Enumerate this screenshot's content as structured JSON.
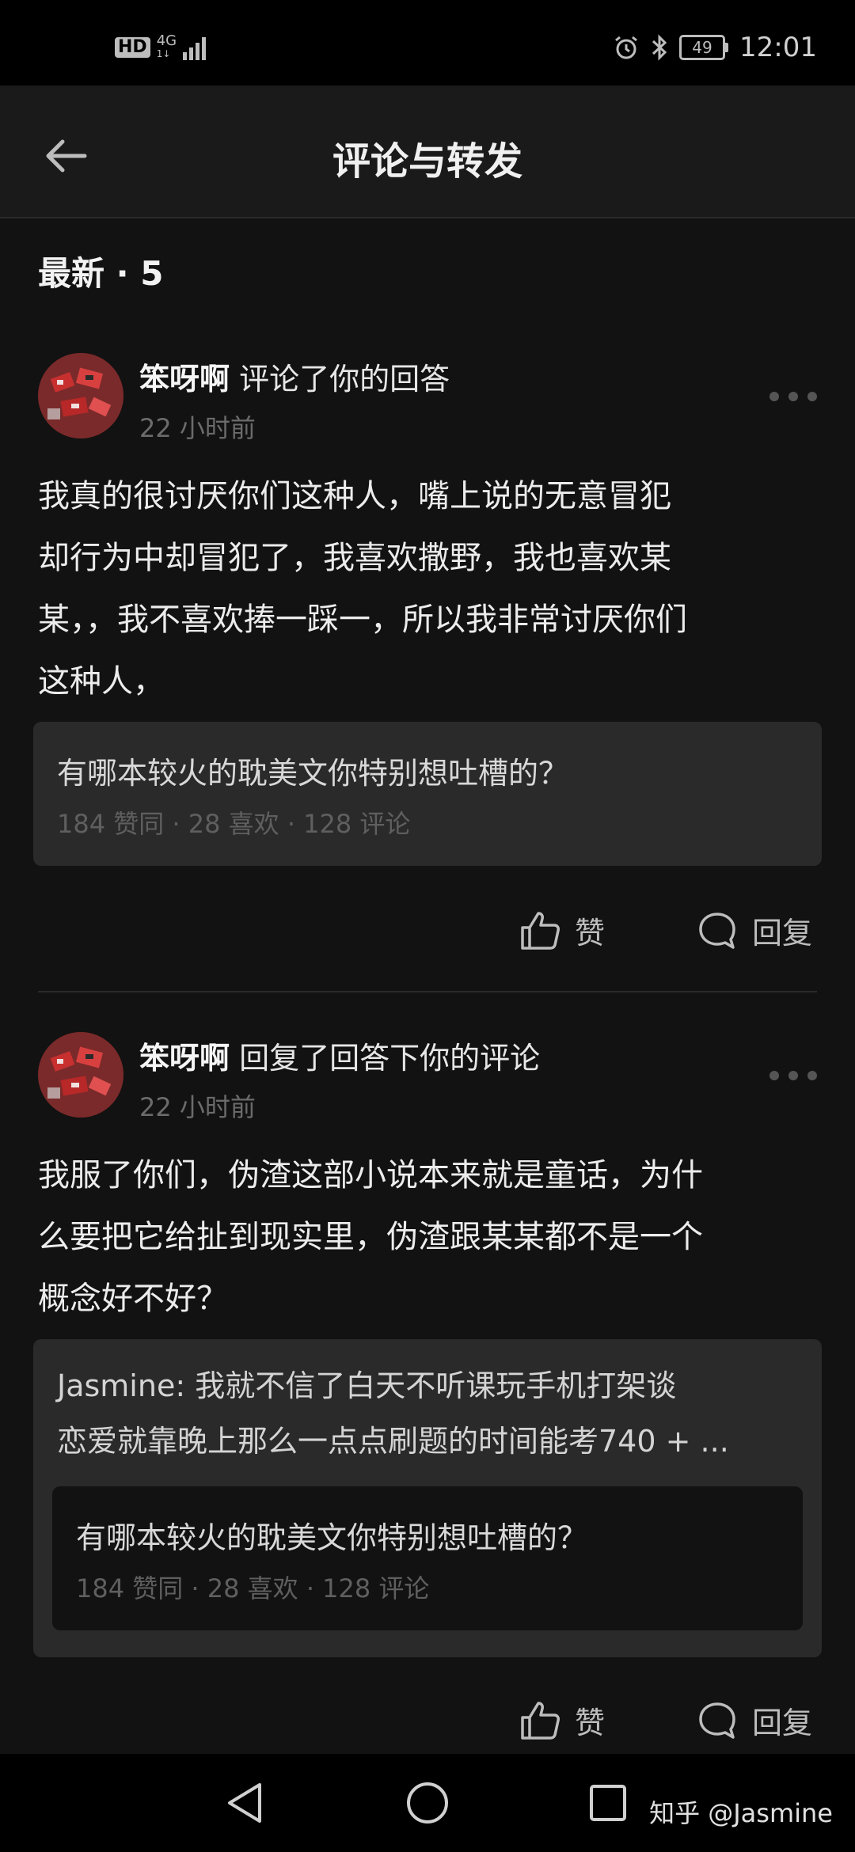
{
  "status_bar": {
    "hd": "HD",
    "network": "4G",
    "network_sub": "1↓",
    "battery": "49",
    "time": "12:01"
  },
  "header": {
    "title": "评论与转发"
  },
  "section": {
    "title": "最新 · 5"
  },
  "notifications": [
    {
      "user": "笨呀啊",
      "action": " 评论了你的回答",
      "time": "22 小时前",
      "text_lines": [
        "我真的很讨厌你们这种人，嘴上说的无意冒犯",
        "却行为中却冒犯了，我喜欢撒野，我也喜欢某",
        "某，，我不喜欢捧一踩一，所以我非常讨厌你们",
        "这种人，"
      ],
      "quote": {
        "title": "有哪本较火的耽美文你特别想吐槽的？",
        "stats": "184 赞同 · 28 喜欢 · 128 评论"
      },
      "like_label": "赞",
      "reply_label": "回复"
    },
    {
      "user": "笨呀啊",
      "action": " 回复了回答下你的评论",
      "time": "22 小时前",
      "text_lines": [
        "我服了你们，伪渣这部小说本来就是童话，为什",
        "么要把它给扯到现实里，伪渣跟某某都不是一个",
        "概念好不好？"
      ],
      "reply_to": {
        "lines": [
          "Jasmine: 我就不信了白天不听课玩手机打架谈",
          "恋爱就靠晚上那么一点点刷题的时间能考740 + ..."
        ]
      },
      "quote": {
        "title": "有哪本较火的耽美文你特别想吐槽的？",
        "stats": "184 赞同 · 28 喜欢 · 128 评论"
      },
      "like_label": "赞",
      "reply_label": "回复"
    }
  ],
  "watermark": "知乎 @Jasmine",
  "colors": {
    "background": "#121212",
    "header": "#1a1a1a",
    "quote_box": "#2a2a2a",
    "text_primary": "#ececec",
    "text_muted": "#6b6b6b"
  }
}
